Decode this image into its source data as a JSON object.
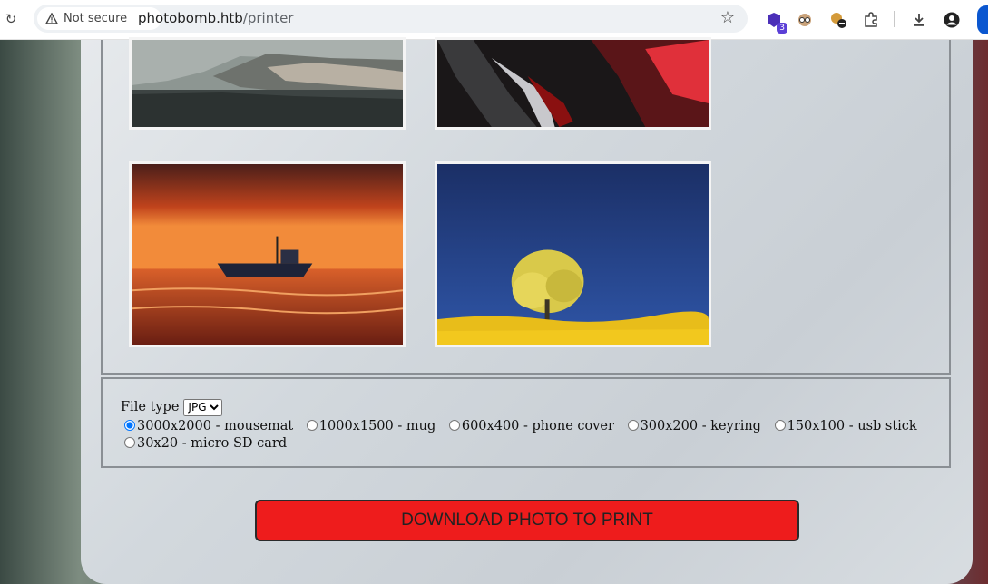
{
  "browser": {
    "security_label": "Not secure",
    "url_host": "photobomb.htb",
    "url_path": "/printer",
    "extension_badge": "3"
  },
  "gallery": {
    "photos": [
      {
        "name": "coastal cliffs photo"
      },
      {
        "name": "red car detail photo"
      },
      {
        "name": "boat at sunset photo"
      },
      {
        "name": "yellow tree photo"
      }
    ]
  },
  "form": {
    "file_type_label": "File type",
    "file_type_selected": "JPG",
    "sizes": [
      {
        "label": "3000x2000 - mousemat",
        "checked": true
      },
      {
        "label": "1000x1500 - mug",
        "checked": false
      },
      {
        "label": "600x400 - phone cover",
        "checked": false
      },
      {
        "label": "300x200 - keyring",
        "checked": false
      },
      {
        "label": "150x100 - usb stick",
        "checked": false
      },
      {
        "label": "30x20 - micro SD card",
        "checked": false
      }
    ],
    "download_label": "DOWNLOAD PHOTO TO PRINT"
  },
  "colors": {
    "download_button": "#ee1c1c"
  }
}
